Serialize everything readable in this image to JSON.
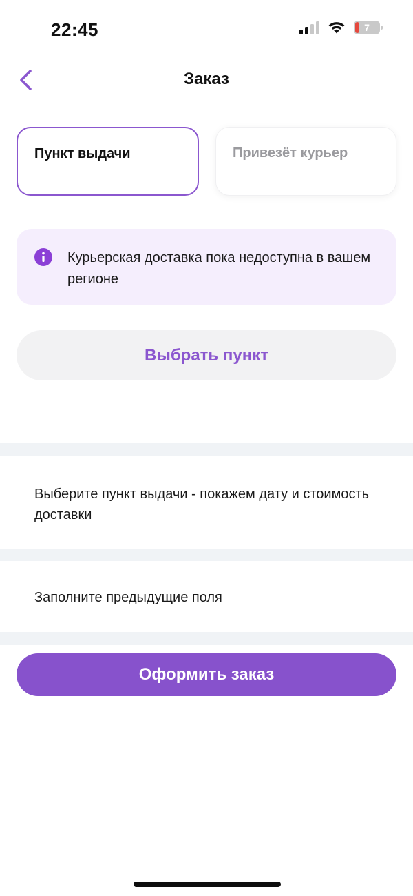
{
  "status_bar": {
    "time": "22:45",
    "battery_level": "7",
    "icons": [
      "cellular-signal-icon",
      "wifi-icon",
      "battery-low-icon"
    ]
  },
  "nav": {
    "title": "Заказ",
    "back_icon": "chevron-left-icon"
  },
  "delivery_tabs": [
    {
      "label": "Пункт выдачи",
      "selected": true
    },
    {
      "label": "Привезёт курьер",
      "selected": false
    }
  ],
  "info_banner": {
    "icon": "info-icon",
    "text": "Курьерская доставка пока недоступна в вашем регионе"
  },
  "choose_point_button": {
    "label": "Выбрать пункт"
  },
  "delivery_hint": {
    "text": "Выберите пункт выдачи - покажем дату и стоимость доставки"
  },
  "fields_hint": {
    "text": "Заполните предыдущие поля"
  },
  "checkout_button": {
    "label": "Оформить заказ"
  },
  "colors": {
    "accent": "#8752cc",
    "banner_bg": "#f5eefd",
    "button_secondary_bg": "#f2f2f3",
    "divider": "#f0f3f6",
    "inactive_text": "#9a9a9e",
    "battery_low": "#e5483d"
  }
}
